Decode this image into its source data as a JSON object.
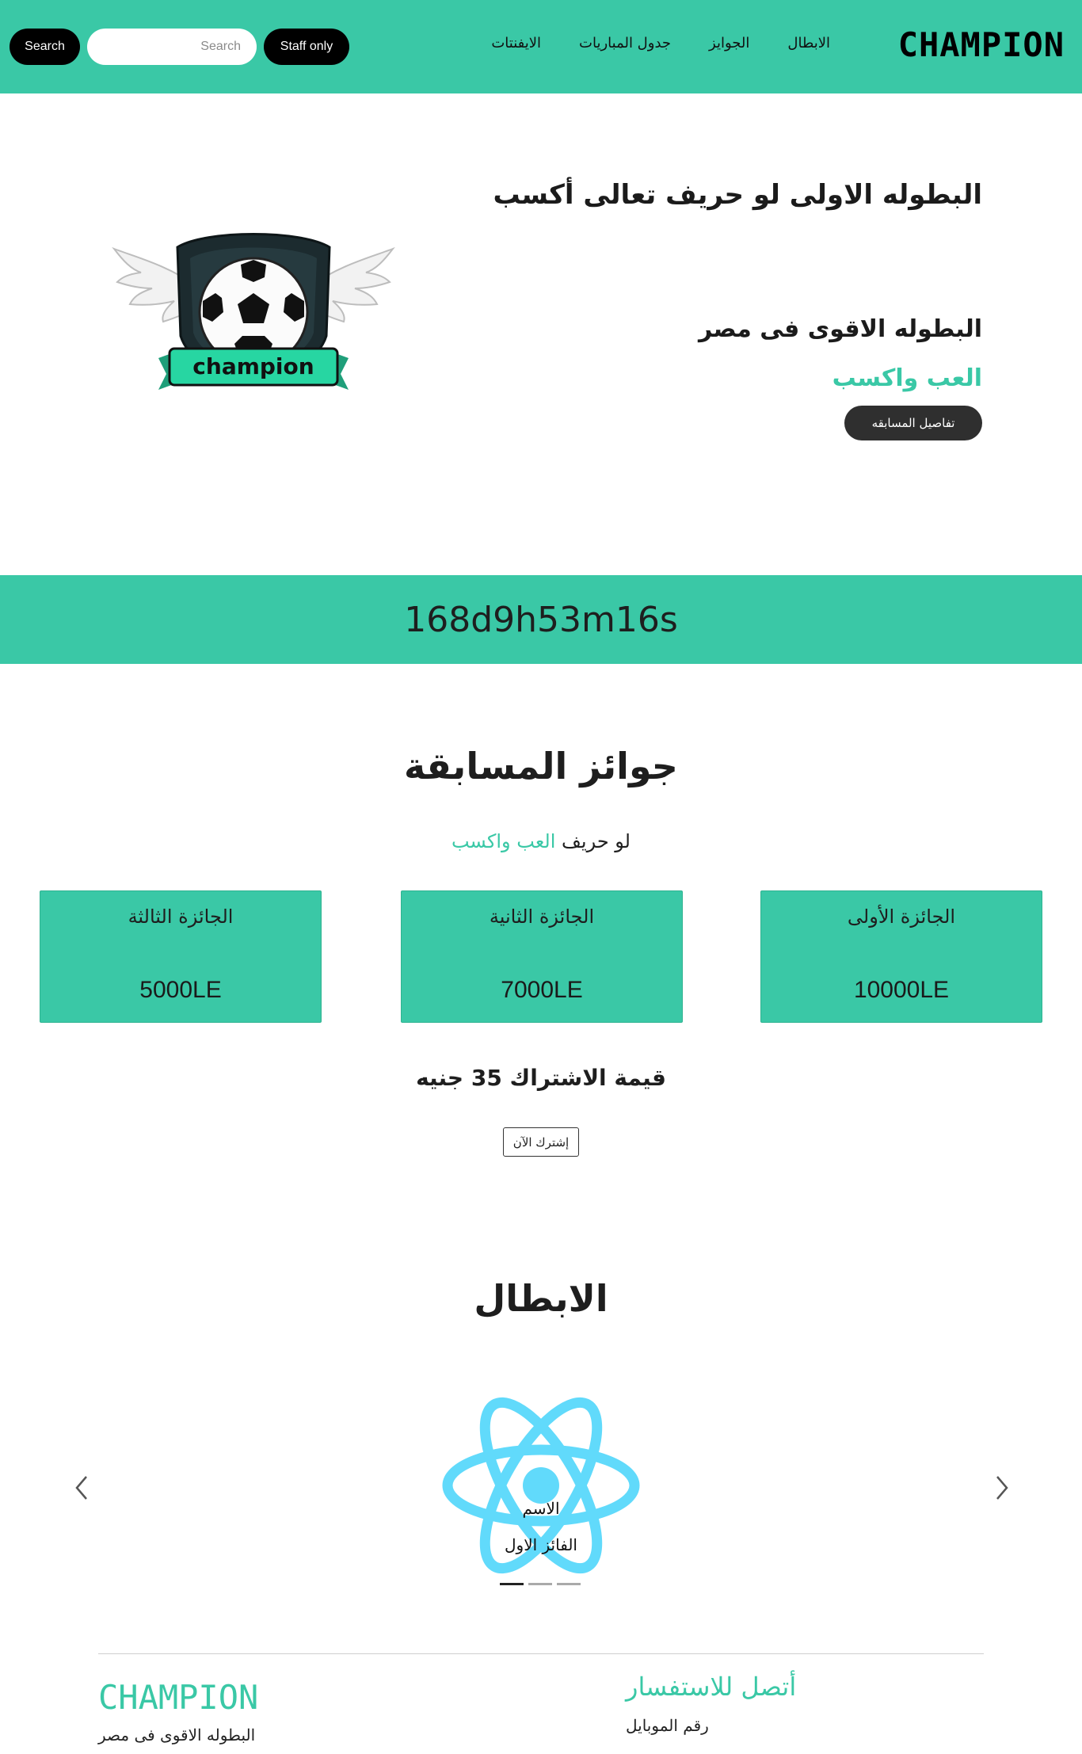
{
  "navbar": {
    "brand": "CHAMPION",
    "links": [
      "الابطال",
      "الجوايز",
      "جدول المباريات",
      "الايفنتات"
    ],
    "search_button": "Search",
    "search_placeholder": "Search",
    "staff_button": "Staff only"
  },
  "hero": {
    "title": "البطوله الاولى لو حريف تعالى أكسب",
    "subtitle": "البطوله الاقوى فى مصر",
    "highlight": "العب واكسب",
    "details_button": "تفاصيل المسابقه",
    "logo_text": "champion"
  },
  "countdown": {
    "text": "168d9h53m16s"
  },
  "prizes": {
    "title": "جوائز المسابقة",
    "subtitle_plain": "لو حريف",
    "subtitle_green": "العب واكسب",
    "cards": [
      {
        "name": "الجائزة الأولى",
        "value": "10000LE"
      },
      {
        "name": "الجائزة الثانية",
        "value": "7000LE"
      },
      {
        "name": "الجائزة الثالثة",
        "value": "5000LE"
      }
    ],
    "fee": "قيمة الاشتراك 35 جنيه",
    "subscribe_button": "إشترك الآن"
  },
  "champions": {
    "title": "الابطال",
    "slide": {
      "name": "الاسم",
      "place": "الفائز الاول"
    },
    "prev_icon": "chevron-left-icon",
    "next_icon": "chevron-right-icon",
    "indicator_count": 3,
    "active_indicator": 0
  },
  "footer": {
    "brand": "CHAMPION",
    "tagline": "البطوله الاقوى فى مصر",
    "contact_title": "أتصل للاستفسار",
    "mobile_label": "رقم الموبايل"
  },
  "colors": {
    "accent": "#3ac8a6",
    "dark": "#2f2f2f",
    "react": "#61dafb"
  }
}
